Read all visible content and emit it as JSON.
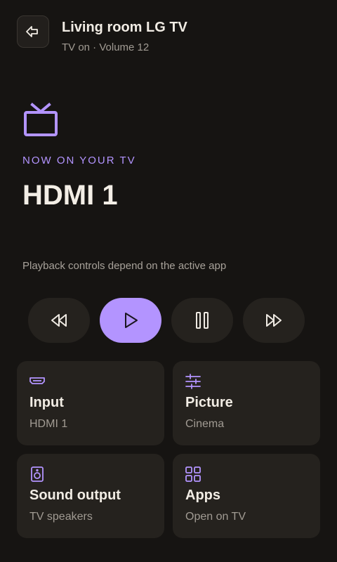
{
  "header": {
    "title": "Living room LG TV",
    "status": "TV on · Volume 12"
  },
  "now_playing": {
    "label": "NOW ON YOUR TV",
    "source": "HDMI 1",
    "hint": "Playback controls depend on the active app"
  },
  "colors": {
    "accent": "#b394ff",
    "background": "#161412",
    "card": "#25221e"
  },
  "tiles": [
    {
      "title": "Input",
      "value": "HDMI 1",
      "icon": "hdmi-icon"
    },
    {
      "title": "Picture",
      "value": "Cinema",
      "icon": "sliders-icon"
    },
    {
      "title": "Sound output",
      "value": "TV speakers",
      "icon": "speaker-icon"
    },
    {
      "title": "Apps",
      "value": "Open on TV",
      "icon": "apps-grid-icon"
    }
  ],
  "controls": [
    "rewind-icon",
    "play-icon",
    "pause-icon",
    "fast-forward-icon"
  ]
}
